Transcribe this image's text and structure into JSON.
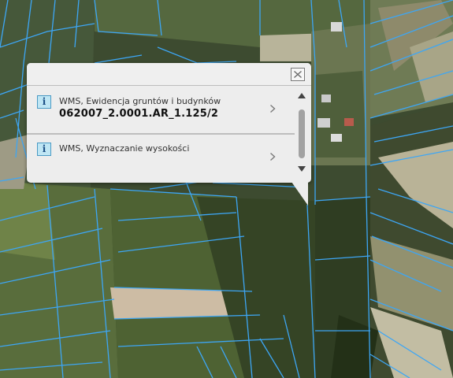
{
  "map": {
    "layer_color": "#3da6f5"
  },
  "popup": {
    "items": [
      {
        "title": "WMS, Ewidencja gruntów i budynków",
        "value": "062007_2.0001.AR_1.125/2",
        "icon": "info-icon"
      },
      {
        "title": "WMS, Wyznaczanie wysokości",
        "value": "",
        "icon": "info-icon"
      }
    ],
    "icons": {
      "close": "close-icon",
      "next": "chevron-right-icon",
      "scroll_up": "scroll-up-arrow-icon",
      "scroll_down": "scroll-down-arrow-icon"
    }
  }
}
